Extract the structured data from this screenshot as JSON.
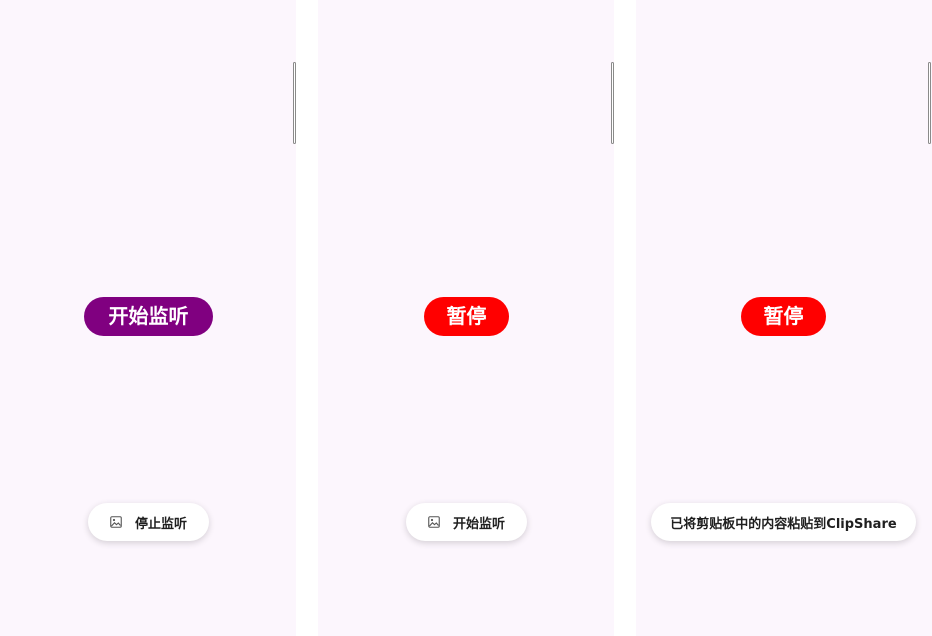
{
  "screens": [
    {
      "button_label": "开始监听",
      "button_color": "#800080",
      "toast_text": "停止监听",
      "toast_icon": "image-icon"
    },
    {
      "button_label": "暂停",
      "button_color": "#ff0000",
      "toast_text": "开始监听",
      "toast_icon": "image-icon"
    },
    {
      "button_label": "暂停",
      "button_color": "#ff0000",
      "toast_text": "已将剪贴板中的内容粘贴到ClipShare"
    }
  ],
  "colors": {
    "screen_background": "#fcf6fd",
    "gutter": "#ffffff"
  }
}
